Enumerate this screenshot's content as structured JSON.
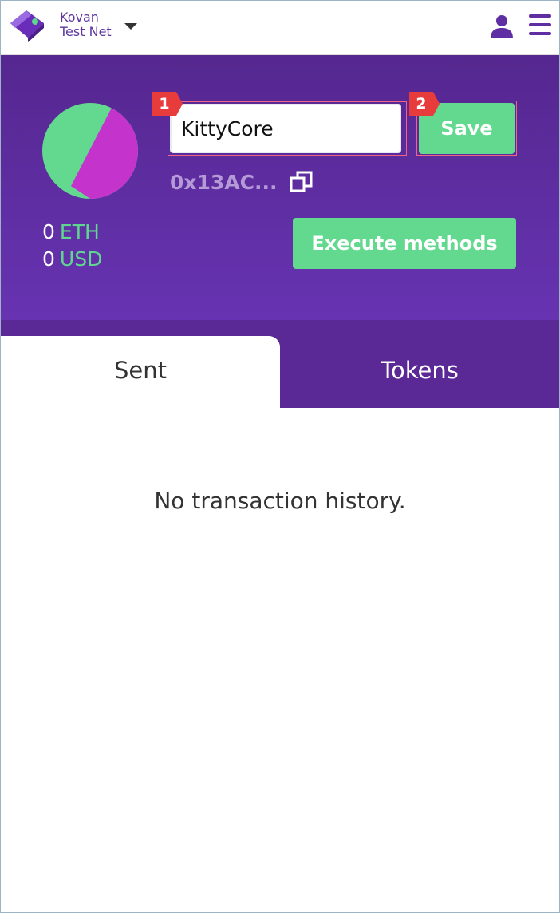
{
  "network": {
    "line1": "Kovan",
    "line2": "Test Net"
  },
  "contract": {
    "name": "KittyCore",
    "address": "0x13AC..."
  },
  "balances": [
    {
      "amount": "0",
      "unit": "ETH"
    },
    {
      "amount": "0",
      "unit": "USD"
    }
  ],
  "buttons": {
    "save": "Save",
    "execute": "Execute methods"
  },
  "badges": [
    "1",
    "2"
  ],
  "tabs": {
    "sent": "Sent",
    "tokens": "Tokens"
  },
  "empty_message": "No transaction history.",
  "colors": {
    "purple_dark": "#55278f",
    "purple": "#6733b2",
    "green": "#62d98e",
    "badge_red": "#e83b3b"
  },
  "icons": {
    "logo": "wallet-logo-icon",
    "dropdown": "caret-down-icon",
    "account": "user-icon",
    "menu": "hamburger-menu-icon",
    "copy": "copy-icon"
  }
}
